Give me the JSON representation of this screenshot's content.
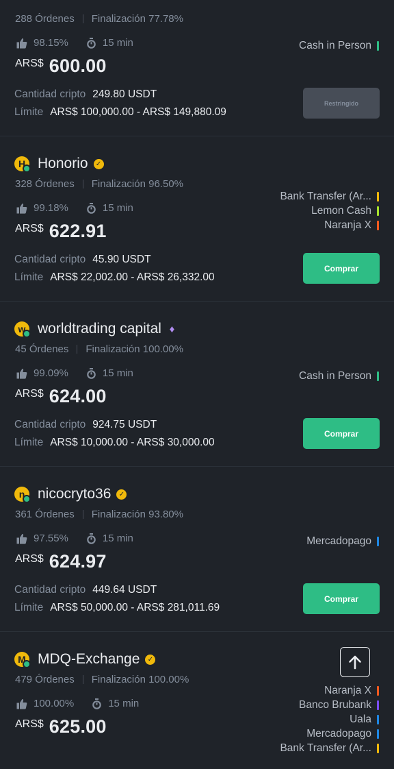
{
  "listings": [
    {
      "advertiser": "",
      "avatar_letter": "",
      "badge": "none",
      "orders": "288 Órdenes",
      "completion": "Finalización 77.78%",
      "positive_rate": "98.15%",
      "pay_time": "15 min",
      "currency": "ARS$",
      "price": "600.00",
      "crypto_label": "Cantidad cripto",
      "crypto_amount": "249.80 USDT",
      "limit_label": "Límite",
      "limit_range": "ARS$ 100,000.00 - ARS$ 149,880.09",
      "payments": [
        {
          "name": "Cash in Person",
          "color": "#2ebd85"
        }
      ],
      "button": "Restringido",
      "button_state": "disabled"
    },
    {
      "advertiser": "Honorio",
      "avatar_letter": "H",
      "badge": "verified",
      "orders": "328 Órdenes",
      "completion": "Finalización 96.50%",
      "positive_rate": "99.18%",
      "pay_time": "15 min",
      "currency": "ARS$",
      "price": "622.91",
      "crypto_label": "Cantidad cripto",
      "crypto_amount": "45.90 USDT",
      "limit_label": "Límite",
      "limit_range": "ARS$ 22,002.00 - ARS$ 26,332.00",
      "payments": [
        {
          "name": "Bank Transfer (Ar...",
          "color": "#f0b90b"
        },
        {
          "name": "Lemon Cash",
          "color": "#a6e22e"
        },
        {
          "name": "Naranja X",
          "color": "#ff5a1f"
        }
      ],
      "button": "Comprar",
      "button_state": "enabled"
    },
    {
      "advertiser": "worldtrading capital",
      "avatar_letter": "w",
      "badge": "diamond",
      "orders": "45 Órdenes",
      "completion": "Finalización 100.00%",
      "positive_rate": "99.09%",
      "pay_time": "15 min",
      "currency": "ARS$",
      "price": "624.00",
      "crypto_label": "Cantidad cripto",
      "crypto_amount": "924.75 USDT",
      "limit_label": "Límite",
      "limit_range": "ARS$ 10,000.00 - ARS$ 30,000.00",
      "payments": [
        {
          "name": "Cash in Person",
          "color": "#2ebd85"
        }
      ],
      "button": "Comprar",
      "button_state": "enabled"
    },
    {
      "advertiser": "nicocryto36",
      "avatar_letter": "n",
      "badge": "verified",
      "orders": "361 Órdenes",
      "completion": "Finalización 93.80%",
      "positive_rate": "97.55%",
      "pay_time": "15 min",
      "currency": "ARS$",
      "price": "624.97",
      "crypto_label": "Cantidad cripto",
      "crypto_amount": "449.64 USDT",
      "limit_label": "Límite",
      "limit_range": "ARS$ 50,000.00 - ARS$ 281,011.69",
      "payments": [
        {
          "name": "Mercadopago",
          "color": "#1e88e5"
        }
      ],
      "button": "Comprar",
      "button_state": "enabled"
    },
    {
      "advertiser": "MDQ-Exchange",
      "avatar_letter": "M",
      "badge": "verified",
      "orders": "479 Órdenes",
      "completion": "Finalización 100.00%",
      "positive_rate": "100.00%",
      "pay_time": "15 min",
      "currency": "ARS$",
      "price": "625.00",
      "crypto_label": "",
      "crypto_amount": "",
      "limit_label": "",
      "limit_range": "",
      "payments": [
        {
          "name": "Naranja X",
          "color": "#ff5a1f"
        },
        {
          "name": "Banco Brubank",
          "color": "#7b4dff"
        },
        {
          "name": "Uala",
          "color": "#1e88e5"
        },
        {
          "name": "Mercadopago",
          "color": "#1e88e5"
        },
        {
          "name": "Bank Transfer (Ar...",
          "color": "#f0b90b"
        }
      ],
      "button": "",
      "button_state": "enabled"
    }
  ],
  "icons": {
    "scroll_top": "arrow-up-icon",
    "rating": "thumbs-up-icon",
    "time": "stopwatch-icon",
    "verified": "verified-check-icon",
    "merchant": "diamond-icon"
  }
}
